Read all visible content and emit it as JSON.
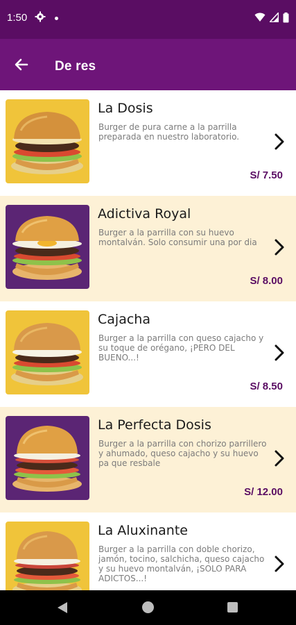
{
  "status": {
    "time": "1:50",
    "icons": [
      "gear-icon",
      "dot-icon",
      "wifi-icon",
      "signal-icon",
      "battery-icon"
    ]
  },
  "header": {
    "title": "De res",
    "back_icon": "arrow-left-icon"
  },
  "colors": {
    "brand_dark": "#5a0d63",
    "brand": "#6e1579",
    "alt_row": "#fdf1d6",
    "price": "#5a0d63"
  },
  "products": [
    {
      "name": "La Dosis",
      "description": "Burger de pura carne a la parrilla preparada en nuestro laboratorio.",
      "price": "S/ 7.50"
    },
    {
      "name": "Adictiva Royal",
      "description": "Burger a la parrilla con su huevo montalván. Solo consumir una por dia",
      "price": "S/ 8.00"
    },
    {
      "name": "Cajacha",
      "description": "Burger a la parrilla con queso cajacho y su toque de orégano, ¡PERO DEL BUENO...!",
      "price": "S/ 8.50"
    },
    {
      "name": "La Perfecta Dosis",
      "description": "Burger a la parrilla con chorizo parrillero y ahumado, queso cajacho y su huevo pa que resbale",
      "price": "S/ 12.00"
    },
    {
      "name": "La Aluxinante",
      "description": "Burger a la parrilla con doble chorizo, jamón, tocino, salchicha, queso cajacho y su huevo montalván, ¡SOLO PARA ADICTOS...!",
      "price": ""
    }
  ],
  "nav": {
    "icons": [
      "nav-back-icon",
      "nav-home-icon",
      "nav-recents-icon"
    ]
  }
}
